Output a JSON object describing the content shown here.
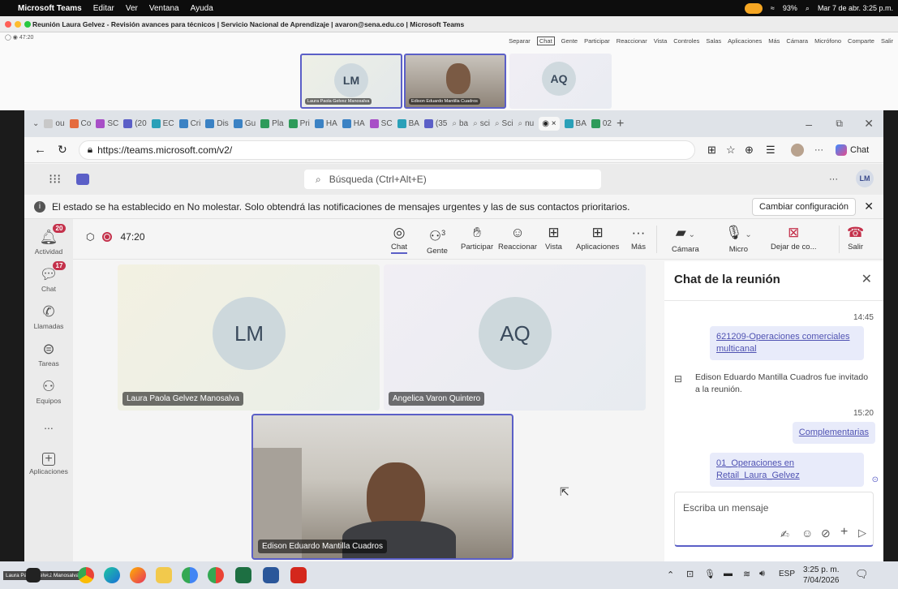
{
  "mac_menubar": {
    "app": "Microsoft Teams",
    "menus": [
      "Editar",
      "Ver",
      "Ventana",
      "Ayuda"
    ],
    "battery": "93%",
    "datetime": "Mar 7 de abr. 3:25 p.m."
  },
  "outer_window": {
    "title": "Reunión Laura Gelvez - Revisión avances para técnicos | Servicio Nacional de Aprendizaje | avaron@sena.edu.co | Microsoft Teams",
    "timer": "47:20",
    "menu": [
      "Separar",
      "Chat",
      "Gente",
      "Participar",
      "Reaccionar",
      "Vista",
      "Controles",
      "Salas",
      "Aplicaciones",
      "Más",
      "Cámara",
      "Micrófono",
      "Comparte",
      "Salir"
    ],
    "thumbs": [
      {
        "initials": "LM",
        "name": "Laura Paola Gelvez Manosalva"
      },
      {
        "name": "Edison Eduardo Mantilla Cuadros"
      },
      {
        "initials": "AQ"
      }
    ]
  },
  "browser": {
    "tabs": [
      "ou",
      "Co",
      "SC",
      "(20",
      "EC",
      "Cri",
      "Dis",
      "Gu",
      "Pla",
      "Pri",
      "HA",
      "HA",
      "SC",
      "BA",
      "(35",
      "ba",
      "sci",
      "Sci",
      "nu",
      "",
      "BA",
      "02"
    ],
    "url": "https://teams.microsoft.com/v2/",
    "chat_label": "Chat"
  },
  "teams": {
    "search_placeholder": "Búsqueda (Ctrl+Alt+E)",
    "avatar": "LM",
    "notification": "El estado se ha establecido en No molestar. Solo obtendrá las notificaciones de mensajes urgentes y las de sus contactos prioritarios.",
    "notification_button": "Cambiar configuración",
    "rail": [
      {
        "label": "Actividad",
        "badge": "20"
      },
      {
        "label": "Chat",
        "badge": "17"
      },
      {
        "label": "Llamadas"
      },
      {
        "label": "Tareas"
      },
      {
        "label": "Equipos"
      },
      {
        "label": "..."
      },
      {
        "label": "Aplicaciones"
      }
    ]
  },
  "meeting": {
    "timer": "47:20",
    "people_count": "3",
    "controls": [
      "Chat",
      "Gente",
      "Participar",
      "Reaccionar",
      "Vista",
      "Aplicaciones",
      "Más"
    ],
    "device_controls": [
      "Cámara",
      "Micro",
      "Dejar de co...",
      "Salir"
    ],
    "participants": [
      {
        "initials": "LM",
        "name": "Laura Paola Gelvez Manosalva"
      },
      {
        "initials": "AQ",
        "name": "Angelica Varon Quintero"
      },
      {
        "name": "Edison Eduardo Mantilla Cuadros"
      }
    ]
  },
  "chat_panel": {
    "title": "Chat de la reunión",
    "messages": [
      {
        "time": "14:45",
        "text": "621209-Operaciones comerciales multicanal"
      },
      {
        "system": "Edison Eduardo Mantilla Cuadros fue invitado a la reunión."
      },
      {
        "time": "15:20",
        "text": "Complementarias"
      },
      {
        "text": "01_Operaciones en Retail_Laura_Gelvez"
      }
    ],
    "compose_placeholder": "Escriba un mensaje"
  },
  "taskbar": {
    "time": "3:25 p. m.",
    "date": "7/04/2026",
    "lang": "ESP",
    "overlay_name": "Laura Paola Gelvez Manosalva"
  },
  "colors": {
    "accent": "#5b5fc7",
    "leave": "#c4314b",
    "badge": "#c4314b"
  }
}
